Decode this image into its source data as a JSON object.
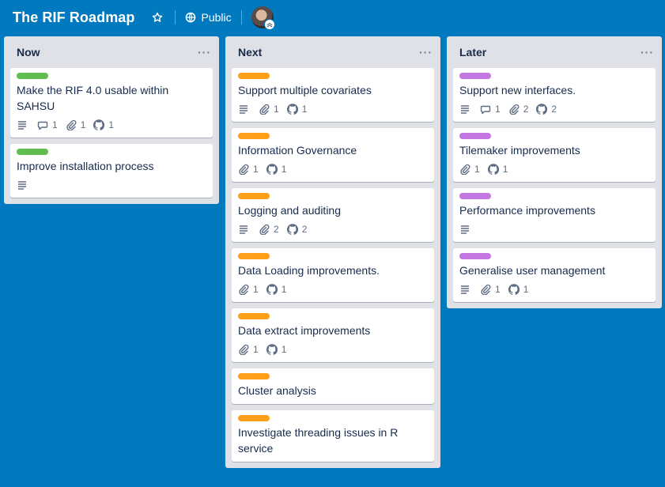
{
  "board": {
    "title": "The RIF Roadmap",
    "visibility": "Public"
  },
  "colors": {
    "background": "#0079bf",
    "label_green": "#61bd4f",
    "label_orange": "#ff9f1a",
    "label_purple": "#c377e0"
  },
  "lists": [
    {
      "title": "Now",
      "menu": "···",
      "cards": [
        {
          "label_color": "#61bd4f",
          "title": "Make the RIF 4.0 usable within SAHSU",
          "description": true,
          "comments": "1",
          "attachments": "1",
          "github": "1"
        },
        {
          "label_color": "#61bd4f",
          "title": "Improve installation process",
          "description": true
        }
      ]
    },
    {
      "title": "Next",
      "menu": "···",
      "cards": [
        {
          "label_color": "#ff9f1a",
          "title": "Support multiple covariates",
          "description": true,
          "attachments": "1",
          "github": "1"
        },
        {
          "label_color": "#ff9f1a",
          "title": "Information Governance",
          "attachments": "1",
          "github": "1"
        },
        {
          "label_color": "#ff9f1a",
          "title": "Logging and auditing",
          "description": true,
          "attachments": "2",
          "github": "2"
        },
        {
          "label_color": "#ff9f1a",
          "title": "Data Loading improvements.",
          "attachments": "1",
          "github": "1"
        },
        {
          "label_color": "#ff9f1a",
          "title": "Data extract improvements",
          "attachments": "1",
          "github": "1"
        },
        {
          "label_color": "#ff9f1a",
          "title": "Cluster analysis"
        },
        {
          "label_color": "#ff9f1a",
          "title": "Investigate threading issues in R service"
        }
      ]
    },
    {
      "title": "Later",
      "menu": "···",
      "cards": [
        {
          "label_color": "#c377e0",
          "title": "Support new interfaces.",
          "description": true,
          "comments": "1",
          "attachments": "2",
          "github": "2"
        },
        {
          "label_color": "#c377e0",
          "title": "Tilemaker improvements",
          "attachments": "1",
          "github": "1"
        },
        {
          "label_color": "#c377e0",
          "title": "Performance improvements",
          "description": true
        },
        {
          "label_color": "#c377e0",
          "title": "Generalise user management",
          "description": true,
          "attachments": "1",
          "github": "1"
        }
      ]
    }
  ]
}
